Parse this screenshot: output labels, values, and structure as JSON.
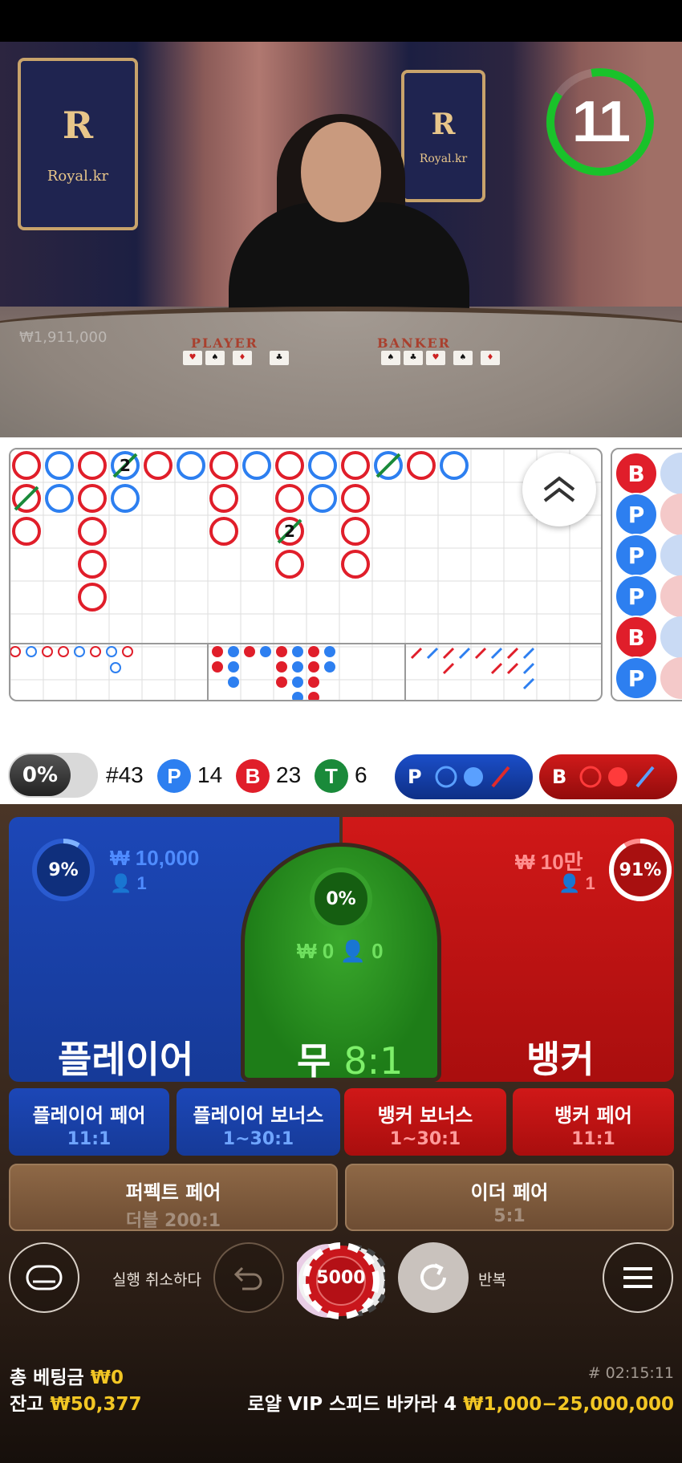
{
  "video": {
    "logo_text": "Royal.kr",
    "logo_letter": "R",
    "timer": "11",
    "overlay_amount": "₩1,911,000",
    "table_player": "PLAYER",
    "table_banker": "BANKER"
  },
  "roadmap": {
    "expand_icon": "double-chevron-up-icon",
    "side_letters": [
      "B",
      "P",
      "P",
      "P",
      "B",
      "P"
    ],
    "tie_mark": "2"
  },
  "stats": {
    "percent": "0%",
    "round": "#43",
    "player_letter": "P",
    "player_count": "14",
    "banker_letter": "B",
    "banker_count": "23",
    "tie_letter": "T",
    "tie_count": "6",
    "player_predict_letter": "P",
    "banker_predict_letter": "B"
  },
  "bets": {
    "player": {
      "label": "플레이어",
      "amount": "₩ 10,000",
      "players": "1",
      "percent": "9%"
    },
    "tie": {
      "label": "무",
      "odds": "8:1",
      "amount": "₩ 0",
      "players": "0",
      "percent": "0%"
    },
    "banker": {
      "label": "뱅커",
      "amount": "₩ 10만",
      "players": "1",
      "percent": "91%"
    },
    "player_pair": {
      "label": "플레이어 페어",
      "odds": "11:1"
    },
    "player_bonus": {
      "label": "플레이어 보너스",
      "odds": "1~30:1"
    },
    "banker_bonus": {
      "label": "뱅커 보너스",
      "odds": "1~30:1"
    },
    "banker_pair": {
      "label": "뱅커 페어",
      "odds": "11:1"
    },
    "perfect_pair": {
      "label": "퍼펙트 페어",
      "odds": "더블 200:1"
    },
    "either_pair": {
      "label": "이더 페어",
      "odds": "5:1"
    }
  },
  "controls": {
    "undo_label": "실행 취소하다",
    "repeat_label": "반복",
    "chip_value": "5000"
  },
  "footer": {
    "total_bet_label": "총 베팅금",
    "total_bet_value": "₩0",
    "balance_label": "잔고",
    "balance_value": "₩50,377",
    "game_id": "# 02:15:11",
    "table_name": "로얄 VIP 스피드 바카라 4",
    "limits": "₩1,000−25,000,000"
  },
  "colors": {
    "player_blue": "#1c47b7",
    "banker_red": "#d01818",
    "tie_green": "#2a9222",
    "gold": "#f2c624"
  }
}
